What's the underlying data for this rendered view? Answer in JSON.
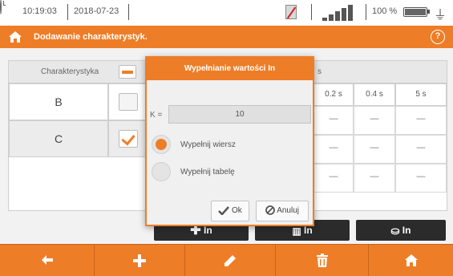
{
  "status_bar": {
    "time": "10:19:03",
    "date": "2018-07-23",
    "battery_percent": "100 %",
    "icons": [
      "clock-icon",
      "no-sim-icon",
      "signal-icon",
      "battery-icon",
      "charger-plug-icon"
    ]
  },
  "title_bar": {
    "title": "Dodawanie charakterystyk.",
    "help_label": "?"
  },
  "table": {
    "header_label": "Charakterystyka",
    "visible_header_fragment": "s",
    "columns": [
      "0.2 s",
      "0.4 s",
      "5 s"
    ],
    "rows": [
      {
        "name": "B",
        "checked": false,
        "values": [
          "—",
          "—",
          "—"
        ]
      },
      {
        "name": "C",
        "checked": true,
        "values": [
          "—",
          "—",
          "—"
        ]
      },
      {
        "name": "",
        "checked": false,
        "values": [
          "—",
          "—",
          "—"
        ]
      }
    ]
  },
  "action_buttons": {
    "add_in_label": "In",
    "delete_in_label": "In",
    "fill_in_label": "In"
  },
  "modal": {
    "title": "Wypełnianie wartości In",
    "k_label": "K =",
    "k_value": "10",
    "options": [
      {
        "label": "Wypełnij wiersz",
        "selected": true
      },
      {
        "label": "Wypełnij tabelę",
        "selected": false
      }
    ],
    "ok_label": "Ok",
    "cancel_label": "Anuluj"
  },
  "toolbar": {
    "buttons": [
      "back-arrow-icon",
      "plus-icon",
      "pencil-icon",
      "trash-icon",
      "home-icon"
    ]
  },
  "colors": {
    "accent": "#ee7d27",
    "dark_button": "#2b2b2b"
  }
}
